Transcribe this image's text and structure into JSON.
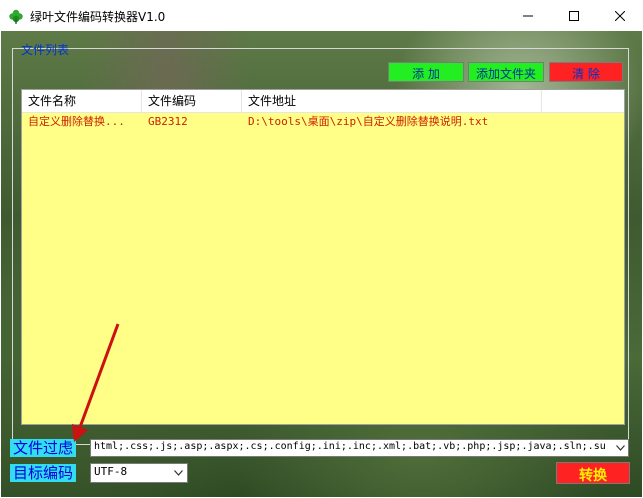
{
  "window": {
    "title": "绿叶文件编码转换器V1.0",
    "icon": "green-leaf-icon",
    "controls": [
      "minimize-icon",
      "maximize-icon",
      "close-icon"
    ]
  },
  "file_list": {
    "group_label": "文件列表",
    "buttons": {
      "add": "添 加",
      "add_folder": "添加文件夹",
      "clear": "清 除"
    },
    "columns": [
      "文件名称",
      "文件编码",
      "文件地址"
    ],
    "rows": [
      {
        "name": "自定义删除替换...",
        "encoding": "GB2312",
        "path": "D:\\tools\\桌面\\zip\\自定义删除替换说明.txt"
      }
    ]
  },
  "filter": {
    "label": "文件过虑",
    "value": "html;.css;.js;.asp;.aspx;.cs;.config;.ini;.inc;.xml;.bat;.vb;.php;.jsp;.java;.sln;.suo"
  },
  "target_encoding": {
    "label": "目标编码",
    "selected": "UTF-8"
  },
  "convert_button": "转换",
  "colors": {
    "list_bg": "#fffe87",
    "button_green": "#22ee22",
    "button_red": "#ff2222",
    "label_cyan": "#33ddf0",
    "label_text": "#0000dd",
    "row_text": "#cc2200",
    "annotation_arrow": "#cc1111"
  }
}
